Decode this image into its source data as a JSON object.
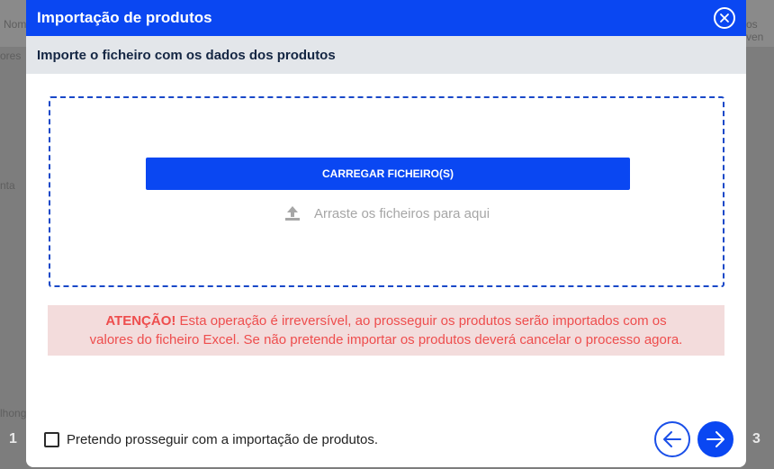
{
  "background": {
    "fragments": [
      "Nom",
      "ores",
      "nta",
      "lhong",
      "os ven",
      "1",
      "3"
    ]
  },
  "modal": {
    "title": "Importação de produtos",
    "close_icon": "close-circle-icon",
    "subtitle": "Importe o ficheiro com os dados dos produtos"
  },
  "dropzone": {
    "upload_button": "CARREGAR FICHEIRO(S)",
    "drag_text": "Arraste os ficheiros para aqui",
    "upload_icon": "upload-icon"
  },
  "warning": {
    "prefix": "ATENÇÃO!",
    "line1": " Esta operação é irreversível, ao prosseguir os produtos serão importados com os",
    "line2": "valores do ficheiro Excel. Se não pretende importar os produtos deverá cancelar o processo agora."
  },
  "footer": {
    "checkbox_label": "Pretendo prosseguir com a importação de produtos.",
    "prev_icon": "arrow-left-icon",
    "next_icon": "arrow-right-icon"
  },
  "colors": {
    "primary": "#0a47f2",
    "warning_text": "#ee4d4d",
    "warning_bg": "#f3dcdc"
  }
}
